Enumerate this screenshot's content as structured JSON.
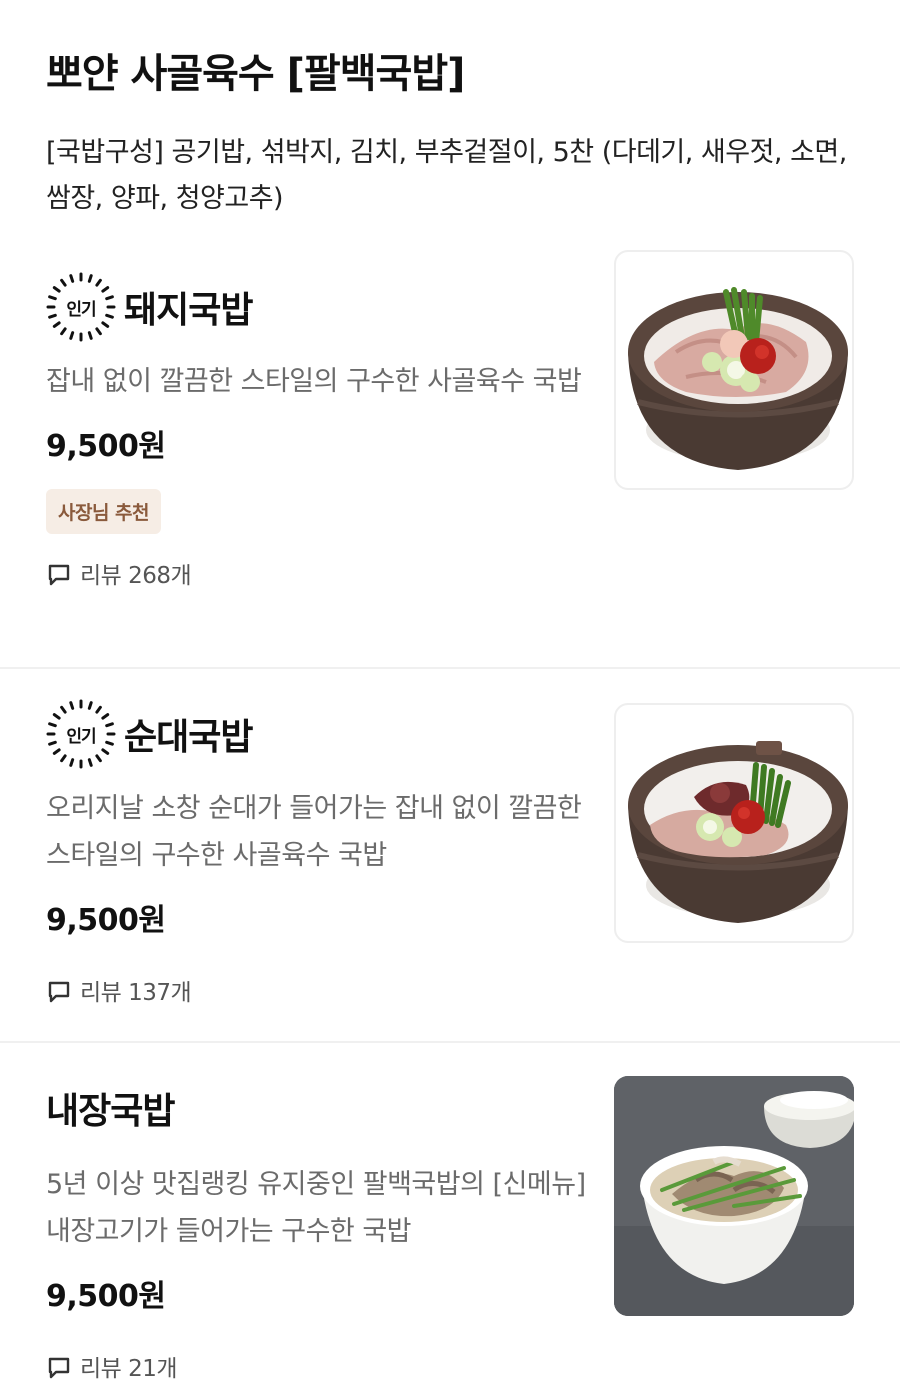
{
  "section": {
    "title": "뽀얀 사골육수 [팔백국밥]",
    "description": "[국밥구성] 공기밥, 섞박지, 김치, 부추겉절이, 5찬 (다데기, 새우젓, 소면, 쌈장, 양파, 청양고추)"
  },
  "menu_items": [
    {
      "popular_badge": "인기",
      "name": "돼지국밥",
      "description": "잡내 없이 깔끔한 스타일의 구수한 사골육수 국밥",
      "price": "9,500원",
      "owner_badge": "사장님 추천",
      "review_label": "리뷰 268개",
      "image_icon": "pork-soup-bowl"
    },
    {
      "popular_badge": "인기",
      "name": "순대국밥",
      "description": "오리지날 소창 순대가 들어가는 잡내 없이 깔끔한 스타일의 구수한 사골육수 국밥",
      "price": "9,500원",
      "review_label": "리뷰 137개",
      "image_icon": "sundae-soup-bowl"
    },
    {
      "name": "내장국밥",
      "description": "5년 이상 맛집랭킹 유지중인 팔백국밥의 [신메뉴] 내장고기가 들어가는 구수한 국밥",
      "price": "9,500원",
      "review_label": "리뷰 21개",
      "image_icon": "intestine-soup-bowl"
    }
  ],
  "colors": {
    "owner_badge_bg": "#f6ede5",
    "owner_badge_text": "#8a5a3c",
    "description_text": "#6b6b6b",
    "divider": "#f0f0f0"
  }
}
